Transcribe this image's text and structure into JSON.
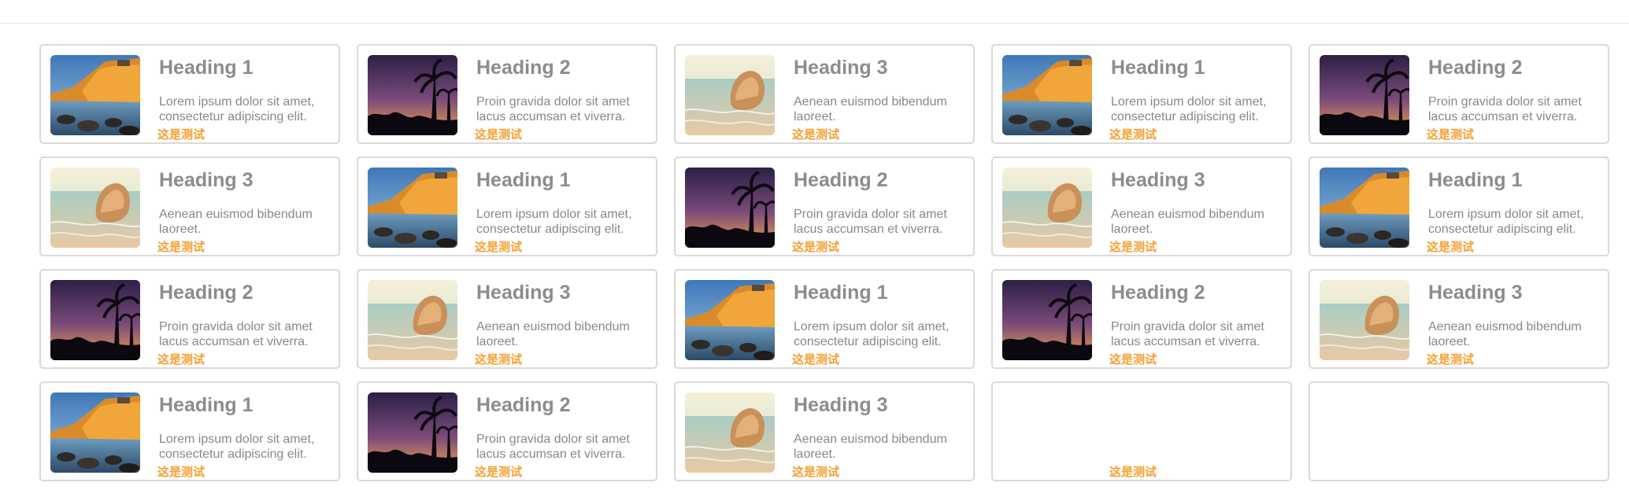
{
  "cards": [
    {
      "heading": "Heading 1",
      "text": "Lorem ipsum dolor sit amet, consectetur adipiscing elit.",
      "tag": "这是测试",
      "image": "coastal-cliff-photo"
    },
    {
      "heading": "Heading 2",
      "text": "Proin gravida dolor sit amet lacus accumsan et viverra.",
      "tag": "这是测试",
      "image": "palm-sunset-photo"
    },
    {
      "heading": "Heading 3",
      "text": "Aenean euismod bibendum laoreet.",
      "tag": "这是测试",
      "image": "beach-rock-photo"
    },
    {
      "heading": "Heading 1",
      "text": "Lorem ipsum dolor sit amet, consectetur adipiscing elit.",
      "tag": "这是测试",
      "image": "coastal-cliff-photo"
    },
    {
      "heading": "Heading 2",
      "text": "Proin gravida dolor sit amet lacus accumsan et viverra.",
      "tag": "这是测试",
      "image": "palm-sunset-photo"
    },
    {
      "heading": "Heading 3",
      "text": "Aenean euismod bibendum laoreet.",
      "tag": "这是测试",
      "image": "beach-rock-photo"
    },
    {
      "heading": "Heading 1",
      "text": "Lorem ipsum dolor sit amet, consectetur adipiscing elit.",
      "tag": "这是测试",
      "image": "coastal-cliff-photo"
    },
    {
      "heading": "Heading 2",
      "text": "Proin gravida dolor sit amet lacus accumsan et viverra.",
      "tag": "这是测试",
      "image": "palm-sunset-photo"
    },
    {
      "heading": "Heading 3",
      "text": "Aenean euismod bibendum laoreet.",
      "tag": "这是测试",
      "image": "beach-rock-photo"
    },
    {
      "heading": "Heading 1",
      "text": "Lorem ipsum dolor sit amet, consectetur adipiscing elit.",
      "tag": "这是测试",
      "image": "coastal-cliff-photo"
    },
    {
      "heading": "Heading 2",
      "text": "Proin gravida dolor sit amet lacus accumsan et viverra.",
      "tag": "这是测试",
      "image": "palm-sunset-photo"
    },
    {
      "heading": "Heading 3",
      "text": "Aenean euismod bibendum laoreet.",
      "tag": "这是测试",
      "image": "beach-rock-photo"
    },
    {
      "heading": "Heading 1",
      "text": "Lorem ipsum dolor sit amet, consectetur adipiscing elit.",
      "tag": "这是测试",
      "image": "coastal-cliff-photo"
    },
    {
      "heading": "Heading 2",
      "text": "Proin gravida dolor sit amet lacus accumsan et viverra.",
      "tag": "这是测试",
      "image": "palm-sunset-photo"
    },
    {
      "heading": "Heading 3",
      "text": "Aenean euismod bibendum laoreet.",
      "tag": "这是测试",
      "image": "beach-rock-photo"
    },
    {
      "heading": "Heading 1",
      "text": "Lorem ipsum dolor sit amet, consectetur adipiscing elit.",
      "tag": "这是测试",
      "image": "coastal-cliff-photo"
    },
    {
      "heading": "Heading 2",
      "text": "Proin gravida dolor sit amet lacus accumsan et viverra.",
      "tag": "这是测试",
      "image": "palm-sunset-photo"
    },
    {
      "heading": "Heading 3",
      "text": "Aenean euismod bibendum laoreet.",
      "tag": "这是测试",
      "image": "beach-rock-photo"
    },
    {
      "heading": "",
      "text": "",
      "tag": "这是测试",
      "image": ""
    },
    {
      "heading": "",
      "text": "",
      "tag": "",
      "image": ""
    }
  ],
  "colors": {
    "heading": "#8c8c8c",
    "body_text": "#888888",
    "tag": "#f5a030",
    "card_border": "#d9d9d9"
  }
}
